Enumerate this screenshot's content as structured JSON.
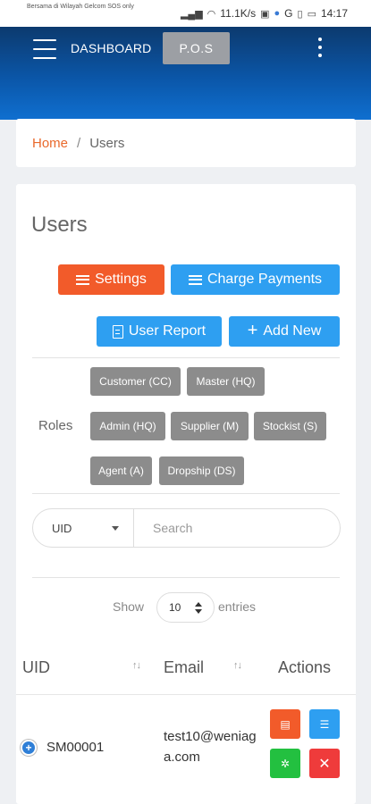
{
  "status_bar": {
    "carrier": "Bersama di Wilayah Gelcom SOS only",
    "net_speed": "11.1K/s",
    "network": "G",
    "time": "14:17"
  },
  "header": {
    "dashboard_label": "DASHBOARD",
    "pos_label": "P.O.S"
  },
  "breadcrumb": {
    "home": "Home",
    "separator": "/",
    "current": "Users"
  },
  "page": {
    "title": "Users",
    "buttons": {
      "settings": "Settings",
      "charge_payments": "Charge Payments",
      "user_report": "User Report",
      "add_new": "Add New"
    }
  },
  "roles": {
    "label": "Roles",
    "items": [
      "Customer (CC)",
      "Master (HQ)",
      "Admin (HQ)",
      "Supplier (M)",
      "Stockist (S)",
      "Agent (A)",
      "Dropship (DS)"
    ]
  },
  "search": {
    "field_selected": "UID",
    "placeholder": "Search"
  },
  "entries": {
    "show_label": "Show",
    "value": "10",
    "entries_label": "entries"
  },
  "table": {
    "columns": [
      "UID",
      "Email",
      "Actions"
    ],
    "rows": [
      {
        "uid": "SM00001",
        "email": "test10@weniaga.com"
      }
    ]
  },
  "colors": {
    "accent_orange": "#f25b2a",
    "accent_blue": "#2e9ff1",
    "role_gray": "#8c8c8c",
    "header_blue": "#0b56a8",
    "action_green": "#23c040",
    "action_red": "#ef3b3b"
  },
  "icons": {
    "menu": "hamburger-icon",
    "more": "kebab-icon",
    "report": "document-icon",
    "add": "plus-icon",
    "sort": "sort-icon",
    "expand": "expand-icon",
    "edit": "edit-icon",
    "list": "list-icon",
    "activate": "activate-icon",
    "delete": "close-icon"
  }
}
